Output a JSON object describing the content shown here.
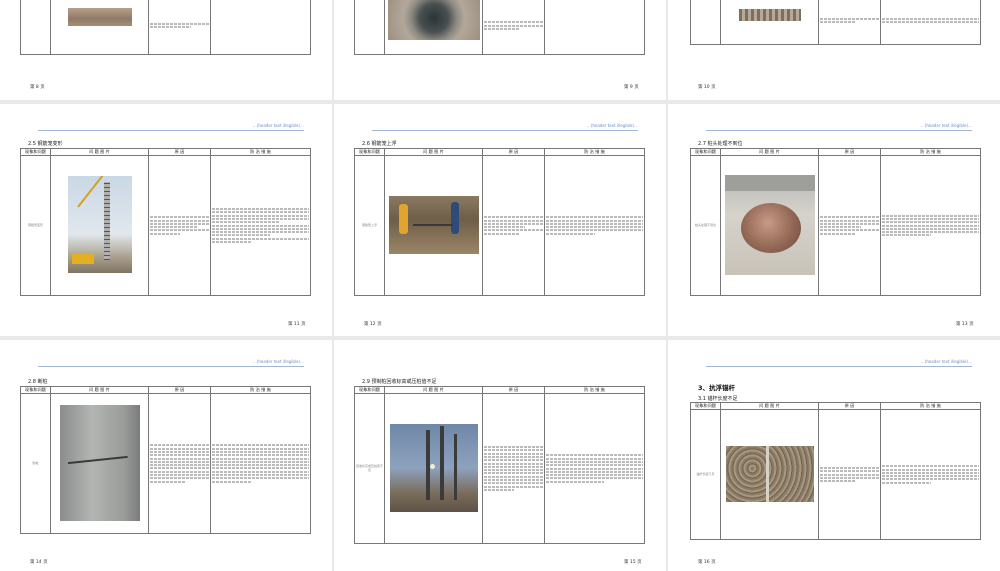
{
  "header_text": "…(header text illegible)…",
  "table_headers": [
    "现象和问题",
    "问 题 图 片",
    "原 因",
    "防 治 措 施"
  ],
  "pages": [
    {
      "id": "p8",
      "page_label": "第 8 页"
    },
    {
      "id": "p9",
      "page_label": "第 9 页"
    },
    {
      "id": "p10",
      "page_label": "第 10 页"
    },
    {
      "id": "p11",
      "page_label": "第 11 页",
      "section": "2.5 钢筋笼变形",
      "row_label": "钢筋笼变形"
    },
    {
      "id": "p12",
      "page_label": "第 12 页",
      "section": "2.6 钢筋笼上浮",
      "row_label": "钢筋笼上浮"
    },
    {
      "id": "p13",
      "page_label": "第 13 页",
      "section": "2.7 桩头处理不到位",
      "row_label": "桩头处理不到位"
    },
    {
      "id": "p14",
      "page_label": "第 14 页",
      "section": "2.8 断桩",
      "row_label": "断桩"
    },
    {
      "id": "p15",
      "page_label": "第 15 页",
      "section": "2.9 预制桩回收标高或压桩值不足",
      "row_label": "回收标高或压桩值不足"
    },
    {
      "id": "p16",
      "page_label": "第 16 页",
      "section": "3.1 锚杆长度不足",
      "big_section": "3、抗浮锚杆",
      "row_label": "锚杆长度不足"
    }
  ],
  "colors": {
    "header_blue": "#6a8fc0",
    "rule": "#9fb7d6",
    "page_bg": "#ffffff",
    "desk_bg": "#e9e9e9"
  }
}
